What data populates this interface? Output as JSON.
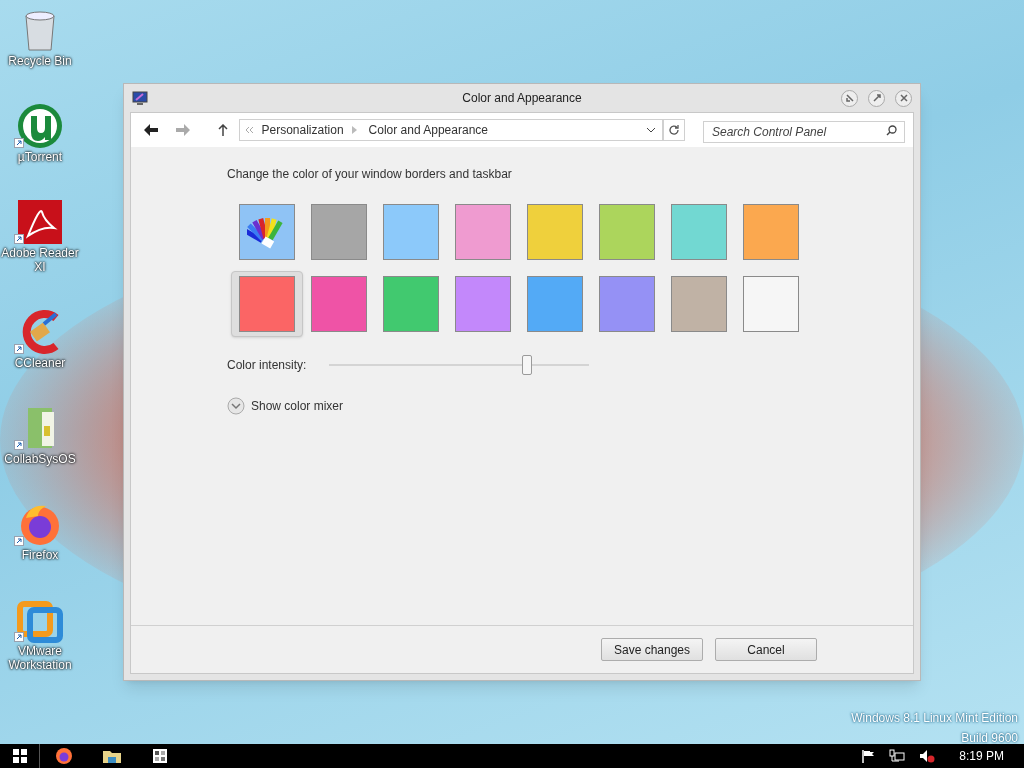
{
  "desktop_icons": [
    {
      "label": "Recycle Bin",
      "kind": "bin",
      "shortcut": false
    },
    {
      "label": "µTorrent",
      "kind": "torrent",
      "shortcut": true
    },
    {
      "label": "Adobe Reader XI",
      "kind": "reader",
      "shortcut": true
    },
    {
      "label": "CCleaner",
      "kind": "cleaner",
      "shortcut": true
    },
    {
      "label": "CollabSysOS",
      "kind": "folder",
      "shortcut": true
    },
    {
      "label": "Firefox",
      "kind": "firefox",
      "shortcut": true
    },
    {
      "label": "VMware Workstation",
      "kind": "vmware",
      "shortcut": true
    }
  ],
  "window": {
    "title": "Color and Appearance",
    "breadcrumb": [
      "Personalization",
      "Color and Appearance"
    ],
    "search": {
      "placeholder": "Search Control Panel"
    },
    "heading": "Change the color of your window borders and taskbar",
    "swatches": [
      {
        "kind": "auto",
        "color": "#8fc3f5",
        "selected": false
      },
      {
        "kind": "color",
        "color": "#a6a6a6",
        "selected": false
      },
      {
        "kind": "color",
        "color": "#8cc9fa",
        "selected": false
      },
      {
        "kind": "color",
        "color": "#ef9bd0",
        "selected": false
      },
      {
        "kind": "color",
        "color": "#efd03c",
        "selected": false
      },
      {
        "kind": "color",
        "color": "#acd55c",
        "selected": false
      },
      {
        "kind": "color",
        "color": "#72d8d2",
        "selected": false
      },
      {
        "kind": "color",
        "color": "#fba84f",
        "selected": false
      },
      {
        "kind": "color",
        "color": "#fb6565",
        "selected": true
      },
      {
        "kind": "color",
        "color": "#ef53a6",
        "selected": false
      },
      {
        "kind": "color",
        "color": "#41c96f",
        "selected": false
      },
      {
        "kind": "color",
        "color": "#c388fb",
        "selected": false
      },
      {
        "kind": "color",
        "color": "#53aaf6",
        "selected": false
      },
      {
        "kind": "color",
        "color": "#9591f5",
        "selected": false
      },
      {
        "kind": "color",
        "color": "#c0b2a5",
        "selected": false
      },
      {
        "kind": "color",
        "color": "#f6f6f6",
        "selected": false
      }
    ],
    "intensity": {
      "label": "Color intensity:",
      "level": 0.76
    },
    "mixer": {
      "label": "Show color mixer",
      "expanded": false
    },
    "buttons": [
      "Save changes",
      "Cancel"
    ]
  },
  "os_watermark": [
    "Windows 8.1 Linux Mint Edition",
    "Build 9600"
  ],
  "taskbar": {
    "apps": [
      {
        "kind": "firefox"
      },
      {
        "kind": "explorer"
      },
      {
        "kind": "control"
      }
    ],
    "clock": "8:19 PM"
  }
}
